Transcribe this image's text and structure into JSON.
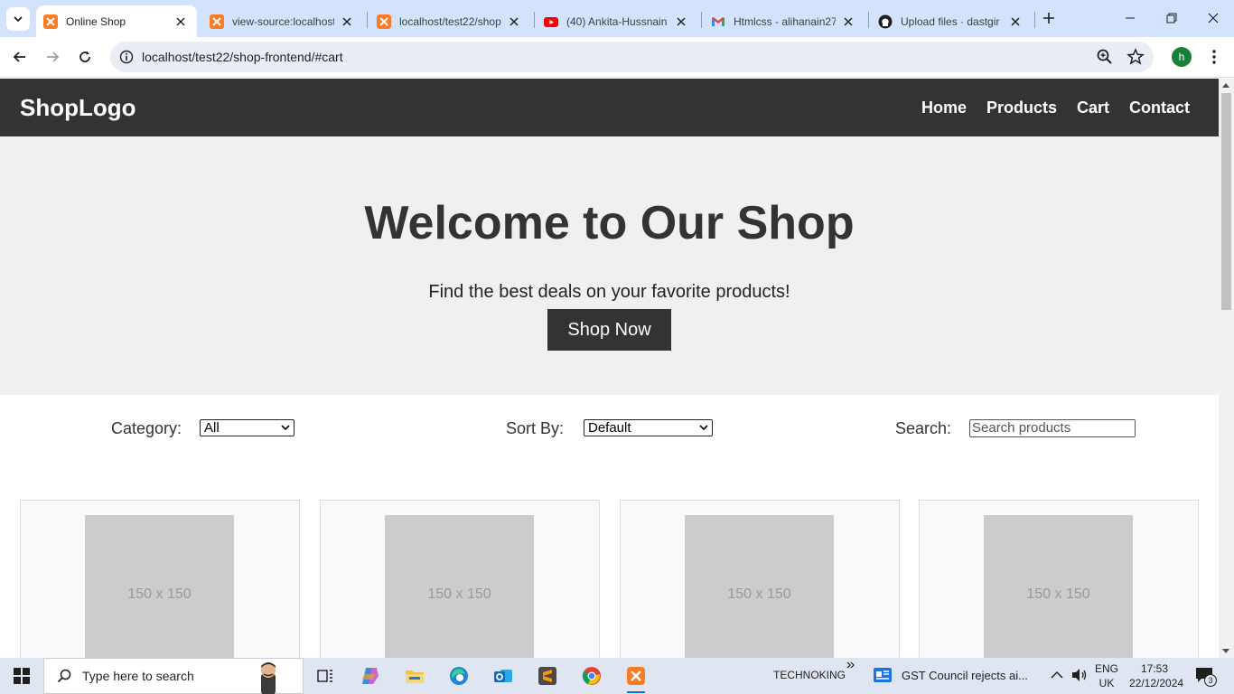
{
  "browser": {
    "tabs": [
      {
        "title": "Online Shop",
        "favicon": "xampp-icon",
        "active": true
      },
      {
        "title": "view-source:localhost",
        "favicon": "xampp-icon"
      },
      {
        "title": "localhost/test22/shop",
        "favicon": "xampp-icon"
      },
      {
        "title": "(40) Ankita-Hussnain",
        "favicon": "youtube-icon"
      },
      {
        "title": "Htmlcss - alihanain27",
        "favicon": "gmail-icon"
      },
      {
        "title": "Upload files · dastgir",
        "favicon": "github-icon"
      }
    ],
    "url": "localhost/test22/shop-frontend/#cart",
    "profile_initial": "h"
  },
  "site": {
    "logo": "ShopLogo",
    "nav": [
      "Home",
      "Products",
      "Cart",
      "Contact"
    ],
    "hero": {
      "title": "Welcome to Our Shop",
      "subtitle": "Find the best deals on your favorite products!",
      "button": "Shop Now"
    },
    "filters": {
      "category_label": "Category:",
      "category_value": "All",
      "sort_label": "Sort By:",
      "sort_value": "Default",
      "search_label": "Search:",
      "search_placeholder": "Search products"
    },
    "products": [
      {
        "image_text": "150 x 150"
      },
      {
        "image_text": "150 x 150"
      },
      {
        "image_text": "150 x 150"
      },
      {
        "image_text": "150 x 150"
      }
    ]
  },
  "taskbar": {
    "search_placeholder": "Type here to search",
    "user_label": "TECHNOKING",
    "news": "GST Council rejects ai...",
    "lang_top": "ENG",
    "lang_bottom": "UK",
    "time": "17:53",
    "date": "22/12/2024",
    "notifications": "3"
  },
  "colors": {
    "header_bg": "#333333",
    "hero_bg": "#f0f0f0",
    "tabstrip_bg": "#d3e3fd",
    "taskbar_bg": "#dfe6f1"
  }
}
